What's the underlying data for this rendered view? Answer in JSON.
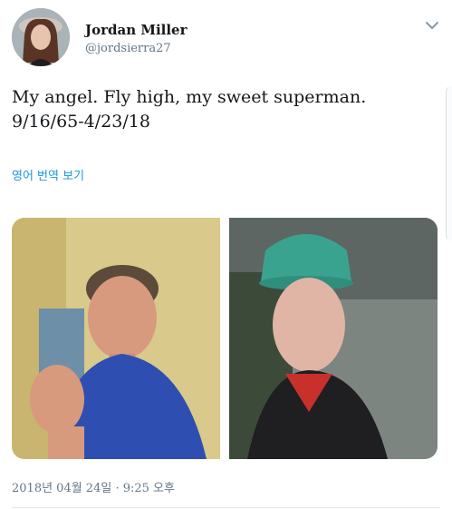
{
  "tweet": {
    "user_name": "Jordan Miller",
    "user_handle": "@jordsierra27",
    "text_line1": "My angel. Fly high, my sweet superman.",
    "text_line2": "9/16/65-4/23/18",
    "translate_label": "영어 번역 보기",
    "timestamp": "2018년 04월 24일 · 9:25 오후"
  },
  "icons": {
    "menu": "chevron-down-icon"
  },
  "colors": {
    "link": "#1b95e0",
    "secondary_text": "#657786",
    "divider": "#e1e8ed"
  }
}
